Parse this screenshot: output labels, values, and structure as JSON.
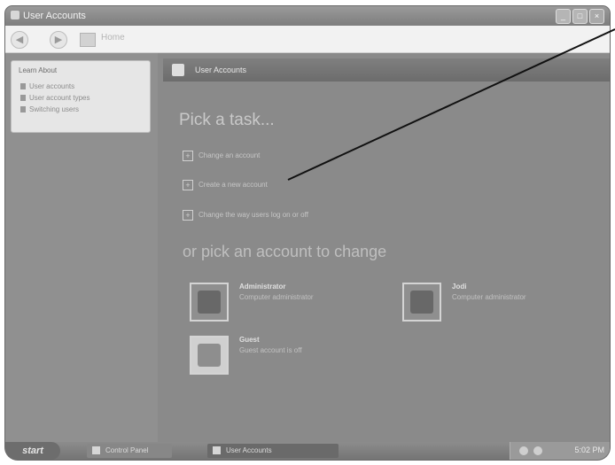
{
  "window": {
    "title": "User Accounts",
    "buttons": [
      "_",
      "□",
      "×"
    ]
  },
  "toolbar": {
    "back_icon": "back-arrow-icon",
    "forward_icon": "forward-arrow-icon",
    "home_icon": "home-icon",
    "text": "Home"
  },
  "sidebar": {
    "learn_title": "Learn About",
    "items": [
      {
        "label": "User accounts"
      },
      {
        "label": "User account types"
      },
      {
        "label": "Switching users"
      }
    ]
  },
  "header": {
    "label": "User Accounts"
  },
  "main": {
    "pick_task": "Pick a task...",
    "tasks": [
      {
        "label": "Change an account"
      },
      {
        "label": "Create a new account"
      },
      {
        "label": "Change the way users log on or off"
      }
    ],
    "pick_account": "or pick an account to change",
    "accounts": [
      {
        "name": "Administrator",
        "role": "Computer administrator"
      },
      {
        "name": "Jodi",
        "role": "Computer administrator"
      },
      {
        "name": "Guest",
        "role": "Guest account is off"
      }
    ]
  },
  "taskbar": {
    "start": "start",
    "tasks": [
      {
        "label": "Control Panel"
      },
      {
        "label": "User Accounts"
      }
    ],
    "clock": "5:02 PM"
  }
}
